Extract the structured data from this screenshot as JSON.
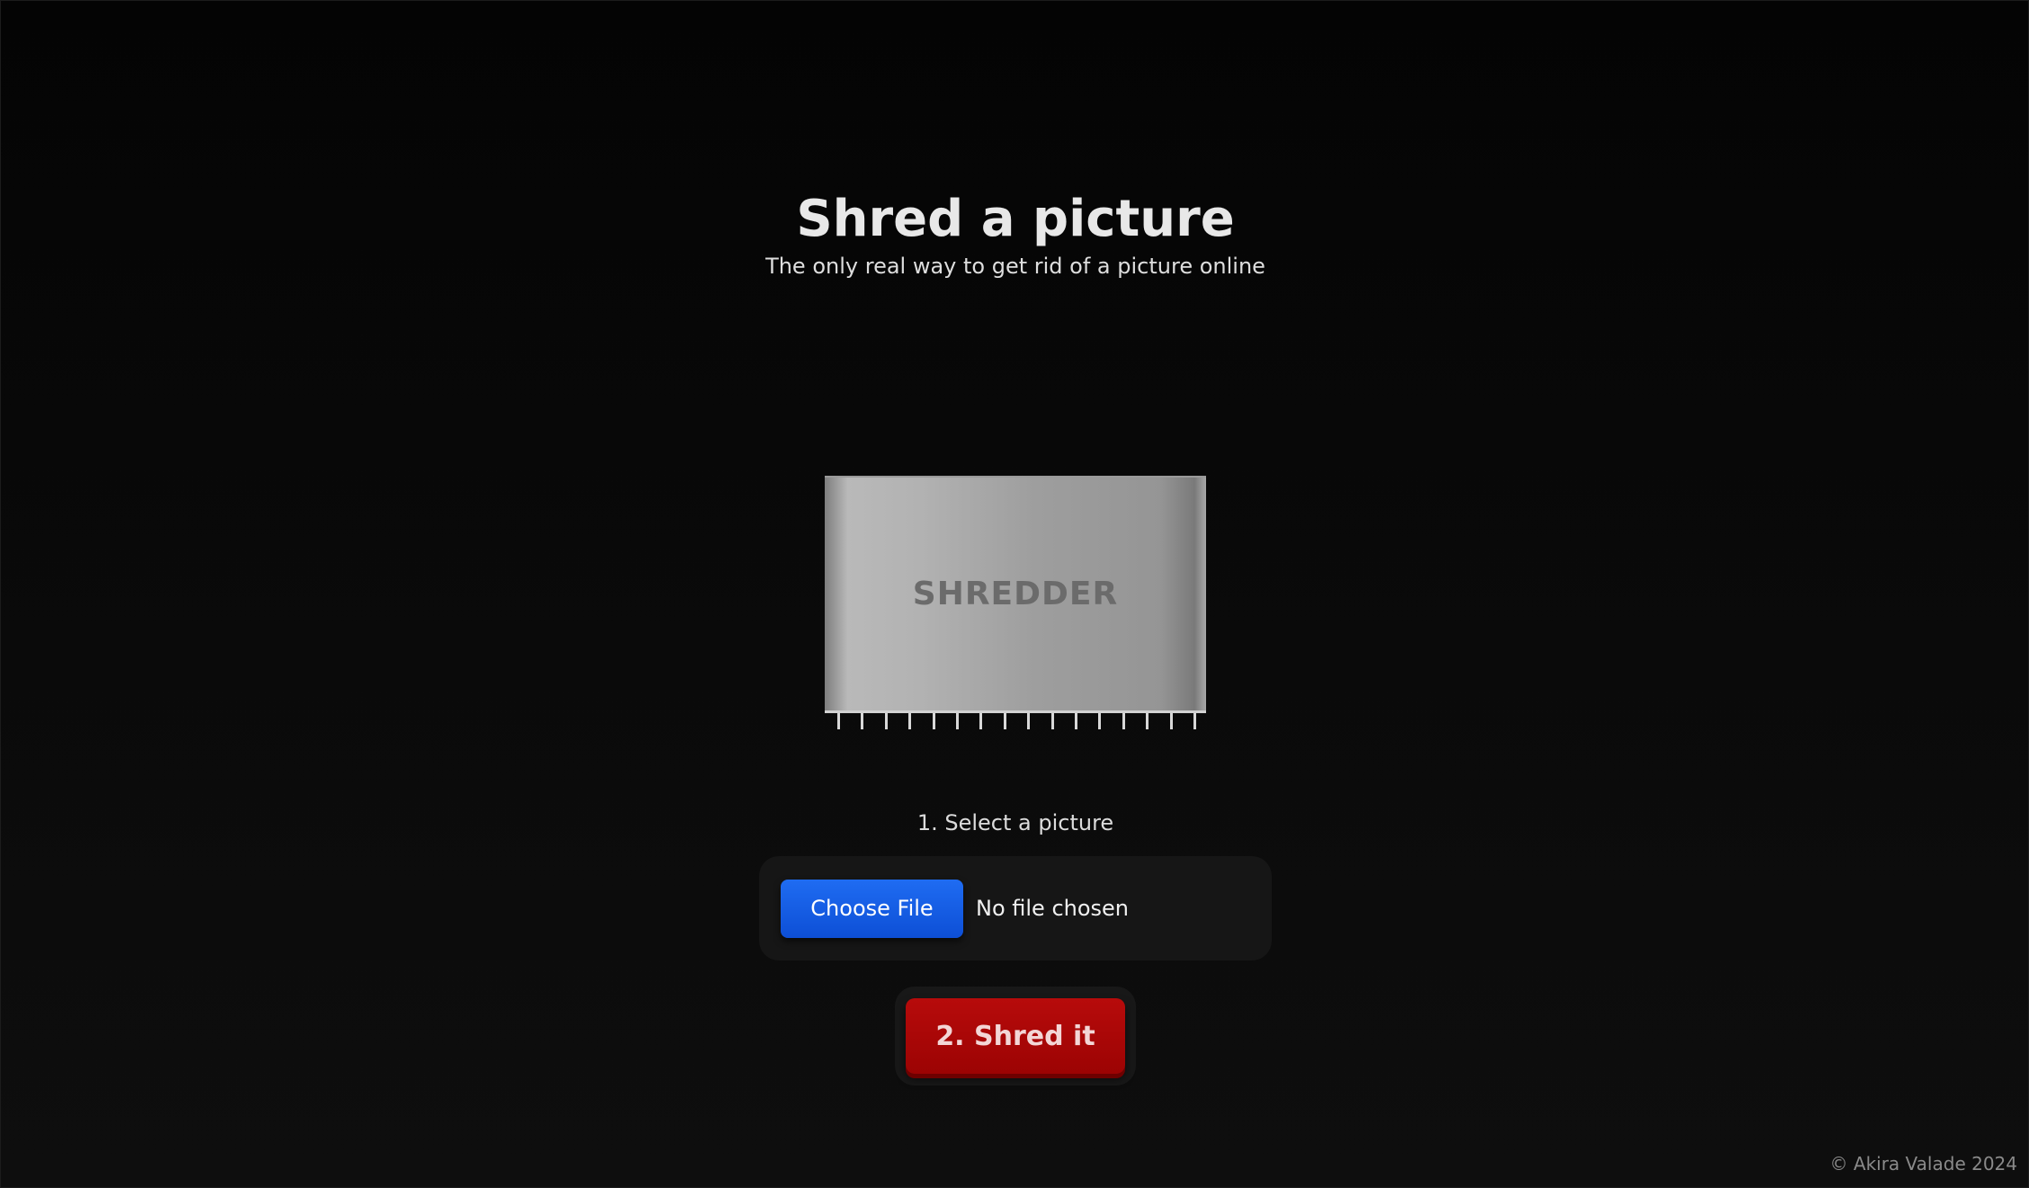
{
  "header": {
    "title": "Shred a picture",
    "subtitle": "The only real way to get rid of a picture online"
  },
  "shredder": {
    "label": "SHREDDER",
    "teeth_count": 16
  },
  "upload": {
    "step_label": "1. Select a picture",
    "button_label": "Choose File",
    "status": "No file chosen"
  },
  "action": {
    "shred_label": "2. Shred it"
  },
  "footer": {
    "copyright": "© Akira Valade 2024"
  },
  "colors": {
    "accent_blue": "#1659e6",
    "accent_red": "#a70606",
    "background": "#0a0a0a"
  }
}
